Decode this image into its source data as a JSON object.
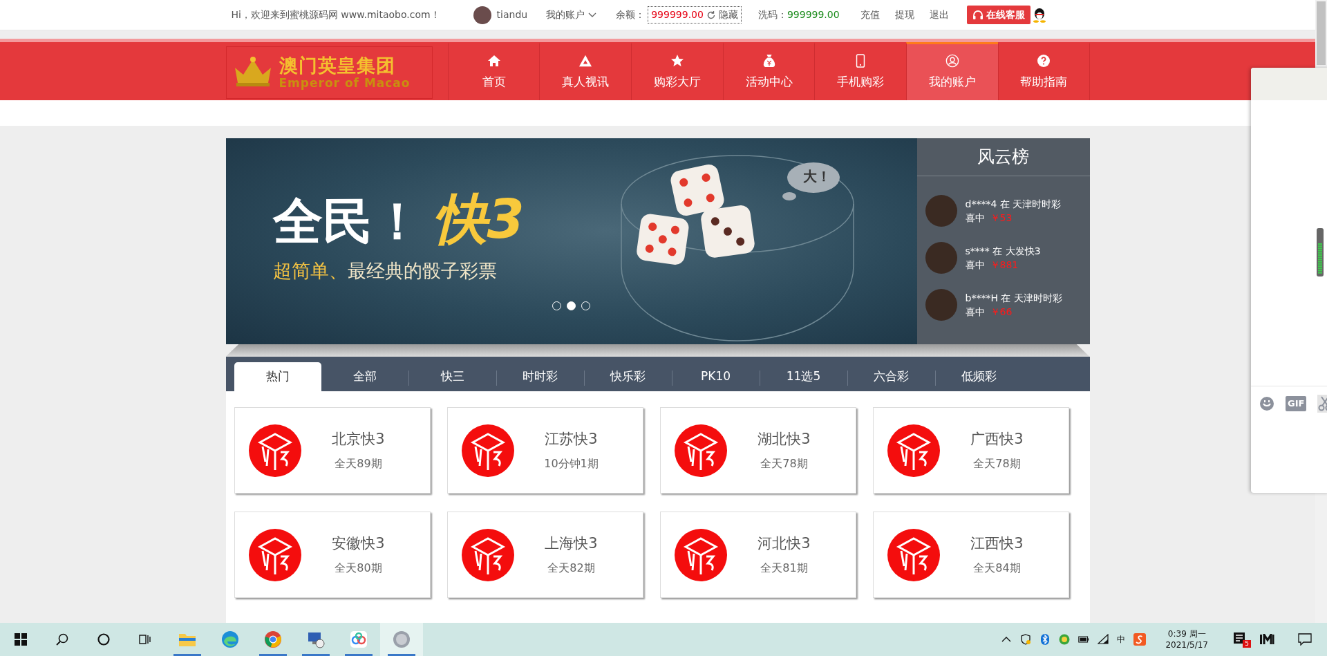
{
  "topbar": {
    "welcome": "Hi，欢迎来到蜜桃源码网 www.mitaobo.com！",
    "username": "tiandu",
    "account_menu": "我的账户",
    "balance_label": "余额：",
    "balance": "999999.00",
    "hide_label": "隐藏",
    "wash_label": "洗码：",
    "wash": "999999.00",
    "links": [
      "充值",
      "提现",
      "退出"
    ],
    "service_button": "在线客服"
  },
  "logo": {
    "title": "澳门英皇集团",
    "subtitle": "Emperor of Macao"
  },
  "nav": [
    {
      "label": "首页",
      "selected": false
    },
    {
      "label": "真人视讯",
      "selected": false
    },
    {
      "label": "购彩大厅",
      "selected": false
    },
    {
      "label": "活动中心",
      "selected": false
    },
    {
      "label": "手机购彩",
      "selected": false
    },
    {
      "label": "我的账户",
      "selected": true
    },
    {
      "label": "帮助指南",
      "selected": false
    }
  ],
  "banner": {
    "headline": "全民！",
    "headline_highlight": "快3",
    "subtitle_highlight": "超简单、",
    "subtitle": "最经典的骰子彩票",
    "bubble": "大！",
    "slides": [
      {
        "selected": false
      },
      {
        "selected": true
      },
      {
        "selected": false
      }
    ]
  },
  "leaderboard": {
    "title": "风云榜",
    "entries": [
      {
        "line": "d****4 在 天津时时彩",
        "won_label": "喜中",
        "amount": "￥53"
      },
      {
        "line": "s**** 在 大发快3",
        "won_label": "喜中",
        "amount": "￥881"
      },
      {
        "line": "b****H 在 天津时时彩",
        "won_label": "喜中",
        "amount": "￥66"
      }
    ]
  },
  "game_tabs": [
    {
      "label": "热门",
      "selected": true
    },
    {
      "label": "全部",
      "selected": false
    },
    {
      "label": "快三",
      "selected": false
    },
    {
      "label": "时时彩",
      "selected": false
    },
    {
      "label": "快乐彩",
      "selected": false
    },
    {
      "label": "PK10",
      "selected": false
    },
    {
      "label": "11选5",
      "selected": false
    },
    {
      "label": "六合彩",
      "selected": false
    },
    {
      "label": "低频彩",
      "selected": false
    }
  ],
  "games": [
    {
      "name": "北京快3",
      "schedule": "全天89期"
    },
    {
      "name": "江苏快3",
      "schedule": "10分钟1期"
    },
    {
      "name": "湖北快3",
      "schedule": "全天78期"
    },
    {
      "name": "广西快3",
      "schedule": "全天78期"
    },
    {
      "name": "安徽快3",
      "schedule": "全天80期"
    },
    {
      "name": "上海快3",
      "schedule": "全天82期"
    },
    {
      "name": "河北快3",
      "schedule": "全天81期"
    },
    {
      "name": "江西快3",
      "schedule": "全天84期"
    }
  ],
  "chat_popup": {
    "gif": "GIF"
  },
  "taskbar": {
    "apps": [
      {
        "running": true,
        "selected": false
      },
      {
        "running": false,
        "selected": false
      },
      {
        "running": true,
        "selected": false
      },
      {
        "running": true,
        "selected": false
      },
      {
        "running": true,
        "selected": false
      },
      {
        "running": true,
        "selected": true
      }
    ],
    "ime": "中",
    "time": "0:39 周一",
    "date": "2021/5/17",
    "notification_count": "5"
  }
}
